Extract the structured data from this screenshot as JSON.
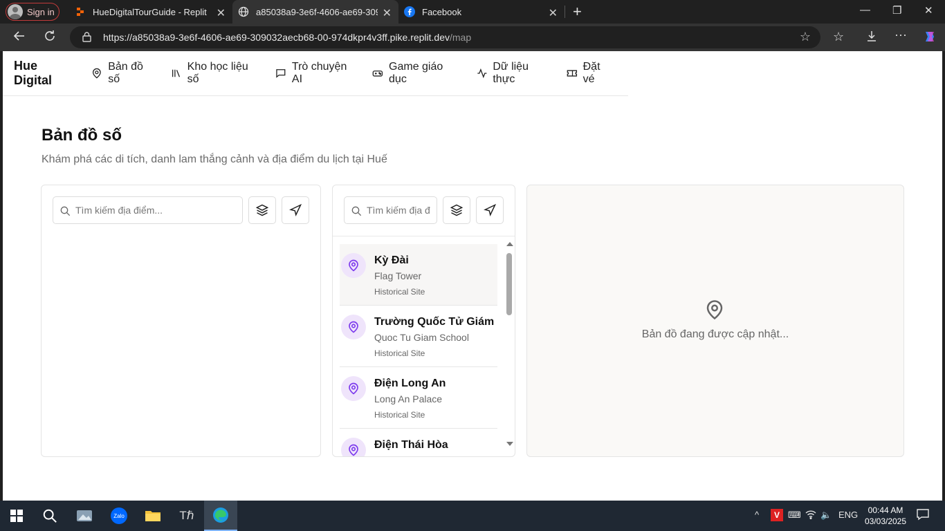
{
  "browser": {
    "signin_label": "Sign in",
    "tabs": [
      {
        "title": "HueDigitalTourGuide - Replit"
      },
      {
        "title": "a85038a9-3e6f-4606-ae69-30903"
      },
      {
        "title": "Facebook"
      }
    ],
    "url_main": "https://a85038a9-3e6f-4606-ae69-309032aecb68-00-974dkpr4v3ff.pike.replit.dev",
    "url_path": "/map"
  },
  "nav": {
    "brand": "Hue Digital",
    "items": [
      {
        "label": "Bản đồ số",
        "icon": "map-pin-icon"
      },
      {
        "label": "Kho học liệu số",
        "icon": "library-icon"
      },
      {
        "label": "Trò chuyện AI",
        "icon": "chat-icon"
      },
      {
        "label": "Game giáo dục",
        "icon": "gamepad-icon"
      },
      {
        "label": "Dữ liệu thực",
        "icon": "activity-icon"
      },
      {
        "label": "Đặt vé",
        "icon": "ticket-icon"
      }
    ]
  },
  "page": {
    "title": "Bản đồ số",
    "subtitle": "Khám phá các di tích, danh lam thắng cảnh và địa điểm du lịch tại Huế"
  },
  "search": {
    "placeholder_wide": "Tìm kiếm địa điểm...",
    "placeholder_narrow": "Tìm kiếm địa đ"
  },
  "places": [
    {
      "name": "Kỳ Đài",
      "english": "Flag Tower",
      "category": "Historical Site"
    },
    {
      "name": "Trường Quốc Tử Giám",
      "english": "Quoc Tu Giam School",
      "category": "Historical Site"
    },
    {
      "name": "Điện Long An",
      "english": "Long An Palace",
      "category": "Historical Site"
    },
    {
      "name": "Điện Thái Hòa",
      "english": "",
      "category": ""
    }
  ],
  "map": {
    "status": "Bản đồ đang được cập nhật..."
  },
  "taskbar": {
    "lang": "ENG",
    "time": "00:44 AM",
    "date": "03/03/2025"
  },
  "colors": {
    "accent": "#7c3aed",
    "pin_bg": "#efe4fb"
  }
}
